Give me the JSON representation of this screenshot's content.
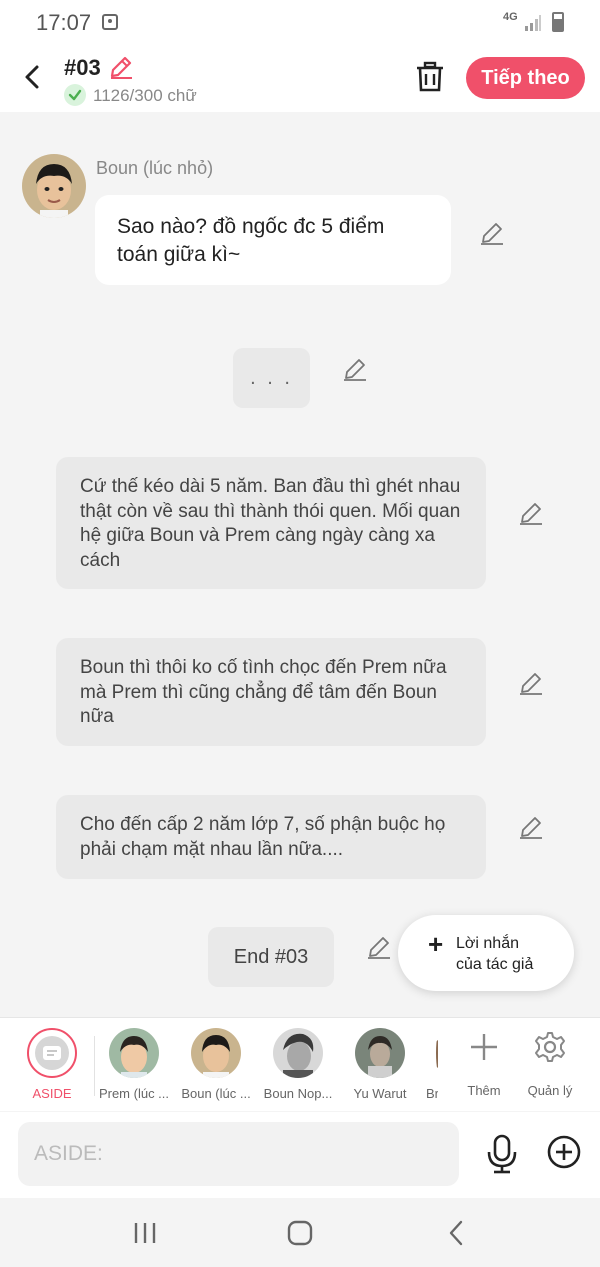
{
  "status": {
    "time": "17:07",
    "network": "4G"
  },
  "header": {
    "episode": "#03",
    "char_count": "1126/300 chữ",
    "next_label": "Tiếp theo"
  },
  "messages": {
    "sender_name": "Boun (lúc nhỏ)",
    "dialogue": "Sao nào? đồ ngốc đc 5 điểm toán giữa kì~",
    "ellipsis": ". . .",
    "narration": [
      "Cứ thế kéo dài 5 năm. Ban đầu thì ghét nhau thật còn về sau thì thành thói quen. Mối quan hệ giữa Boun và Prem càng ngày càng xa cách",
      "Boun thì thôi ko cố tình chọc đến Prem nữa mà Prem thì cũng chẳng để tâm đến Boun nữa",
      "Cho đến cấp 2 năm lớp 7, số phận buộc họ phải chạm mặt nhau lần nữa...."
    ],
    "end_label": "End #03"
  },
  "author_note": {
    "line1": "Lời nhắn",
    "line2": "của tác giả"
  },
  "characters": {
    "aside": "ASIDE",
    "items": [
      {
        "label": "Prem (lúc ..."
      },
      {
        "label": "Boun (lúc ..."
      },
      {
        "label": "Boun Nop..."
      },
      {
        "label": "Yu Warut"
      },
      {
        "label": "Br"
      }
    ],
    "add_label": "Thêm",
    "manage_label": "Quản lý"
  },
  "input": {
    "placeholder": "ASIDE:"
  },
  "colors": {
    "accent": "#f0506a",
    "background": "#f4f4f4",
    "bubble_grey": "#e9e9e9"
  }
}
